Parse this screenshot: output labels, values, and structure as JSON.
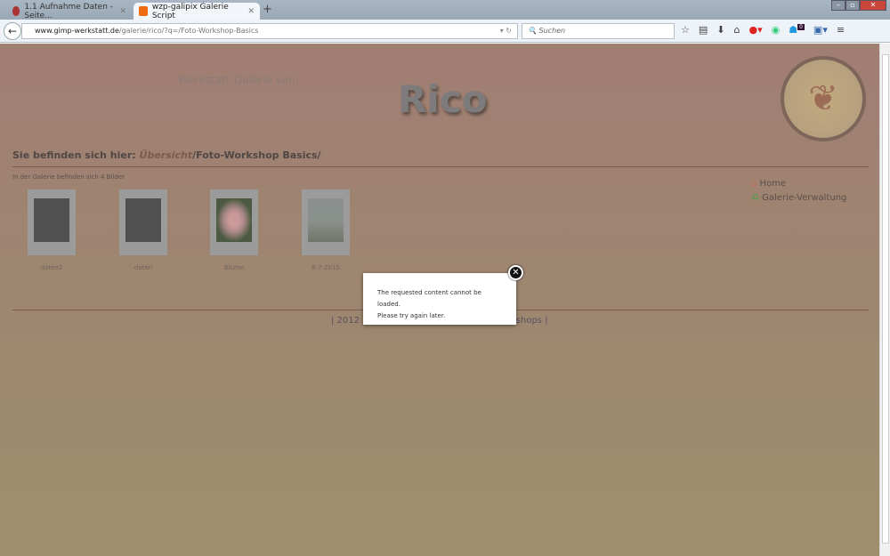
{
  "browser": {
    "tabs": [
      {
        "label": "1.1 Aufnahme Daten - Seite...",
        "active": false
      },
      {
        "label": "wzp-galipix Galerie Script",
        "active": true
      }
    ],
    "url_domain": "www.gimp-werkstatt.de",
    "url_path": "/galerie/rico/?q=/Foto-Workshop-Basics",
    "search_placeholder": "Suchen",
    "badge_count": "0"
  },
  "header": {
    "subtitle": "Werkstatt-Galerie von:",
    "title": "Rico"
  },
  "breadcrumb": {
    "prefix": "Sie befinden sich hier: ",
    "link": "Übersicht",
    "current": "/Foto-Workshop Basics/"
  },
  "gallery": {
    "count_text": "In der Galerie befinden sich 4 Bilder",
    "items": [
      {
        "caption": "daten2"
      },
      {
        "caption": "daten"
      },
      {
        "caption": "Blume"
      },
      {
        "caption": "8-7-2015"
      }
    ]
  },
  "sidenav": {
    "items": [
      {
        "label": "Home"
      },
      {
        "label": "Galerie-Verwaltung"
      }
    ]
  },
  "footer": {
    "left": "| 2012",
    "right": "kshops |"
  },
  "popup": {
    "line1": "The requested content cannot be",
    "line2": "loaded.",
    "line3": "Please try again later."
  }
}
